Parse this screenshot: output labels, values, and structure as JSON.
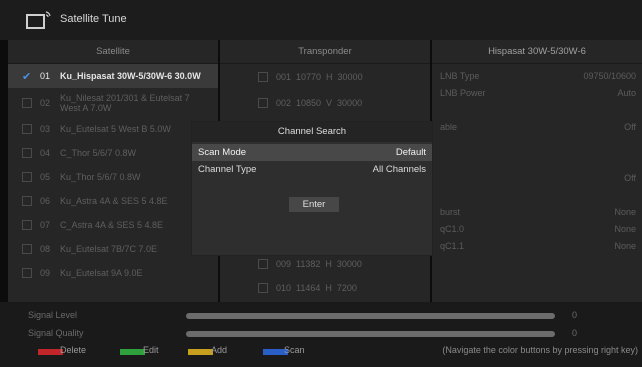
{
  "header": {
    "title": "Satellite Tune",
    "icon": "tv-satellite-icon"
  },
  "satellite_panel": {
    "title": "Satellite",
    "items": [
      {
        "num": "01",
        "name": "Ku_Hispasat 30W-5/30W-6 30.0W",
        "checked": true,
        "selected": true
      },
      {
        "num": "02",
        "name": "Ku_Nilesat 201/301 & Eutelsat 7 West A 7.0W",
        "checked": false,
        "selected": false
      },
      {
        "num": "03",
        "name": "Ku_Eutelsat 5 West B 5.0W",
        "checked": false,
        "selected": false
      },
      {
        "num": "04",
        "name": "C_Thor 5/6/7 0.8W",
        "checked": false,
        "selected": false
      },
      {
        "num": "05",
        "name": "Ku_Thor 5/6/7 0.8W",
        "checked": false,
        "selected": false
      },
      {
        "num": "06",
        "name": "Ku_Astra 4A & SES 5 4.8E",
        "checked": false,
        "selected": false
      },
      {
        "num": "07",
        "name": "C_Astra 4A & SES 5 4.8E",
        "checked": false,
        "selected": false
      },
      {
        "num": "08",
        "name": "Ku_Eutelsat 7B/7C 7.0E",
        "checked": false,
        "selected": false
      },
      {
        "num": "09",
        "name": "Ku_Eutelsat 9A 9.0E",
        "checked": false,
        "selected": false
      }
    ]
  },
  "transponder_panel": {
    "title": "Transponder",
    "items": [
      {
        "text": "001  10770  H  30000"
      },
      {
        "text": "002  10850  V  30000"
      },
      {
        "text": "009  11382  H  30000"
      },
      {
        "text": "010  11464  H  7200"
      }
    ]
  },
  "info_panel": {
    "title": "Hispasat 30W-5/30W-6",
    "rows": [
      {
        "label": "LNB Type",
        "value": "09750/10600"
      },
      {
        "label": "LNB Power",
        "value": "Auto"
      },
      {
        "label": "",
        "value": ""
      },
      {
        "label": "able",
        "value": "Off"
      },
      {
        "label": "",
        "value": ""
      },
      {
        "label": "",
        "value": ""
      },
      {
        "label": "",
        "value": "Off"
      },
      {
        "label": "",
        "value": ""
      },
      {
        "label": "burst",
        "value": "None"
      },
      {
        "label": "qC1.0",
        "value": "None"
      },
      {
        "label": "qC1.1",
        "value": "None"
      }
    ]
  },
  "signal": {
    "level_label": "Signal Level",
    "level_value": "0",
    "quality_label": "Signal Quality",
    "quality_value": "0"
  },
  "color_buttons": [
    {
      "label": "Delete",
      "color": "#c0262a"
    },
    {
      "label": "Edit",
      "color": "#2ea03c"
    },
    {
      "label": "Add",
      "color": "#c8a020"
    },
    {
      "label": "Scan",
      "color": "#2a5fc8"
    }
  ],
  "hint": "(Navigate the color buttons by pressing right key)",
  "dialog": {
    "title": "Channel Search",
    "rows": [
      {
        "label": "Scan Mode",
        "value": "Default",
        "selected": true
      },
      {
        "label": "Channel Type",
        "value": "All Channels",
        "selected": false
      }
    ],
    "enter_label": "Enter"
  }
}
